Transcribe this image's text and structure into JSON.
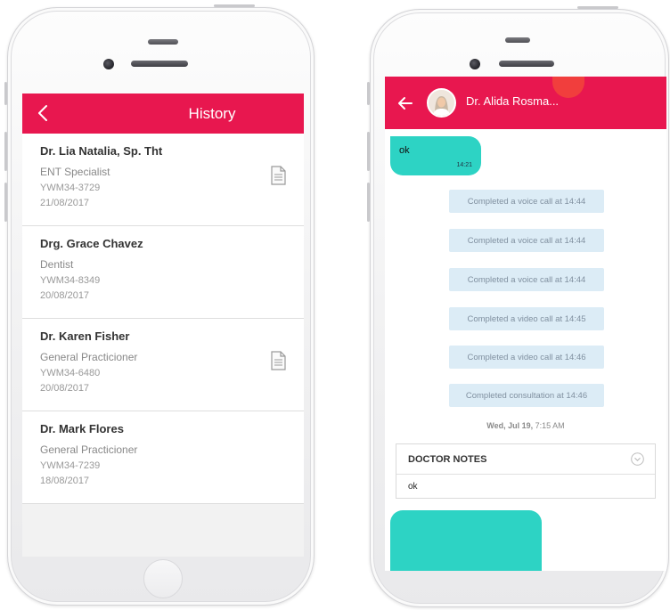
{
  "history_screen": {
    "title": "History",
    "items": [
      {
        "name": "Dr. Lia Natalia, Sp. Tht",
        "specialty": "ENT Specialist",
        "code": "YWM34-3729",
        "date": "21/08/2017",
        "has_document": true
      },
      {
        "name": "Drg. Grace Chavez",
        "specialty": "Dentist",
        "code": "YWM34-8349",
        "date": "20/08/2017",
        "has_document": false
      },
      {
        "name": "Dr. Karen Fisher",
        "specialty": "General Practicioner",
        "code": "YWM34-6480",
        "date": "20/08/2017",
        "has_document": true
      },
      {
        "name": "Dr. Mark Flores",
        "specialty": "General Practicioner",
        "code": "YWM34-7239",
        "date": "18/08/2017",
        "has_document": false
      }
    ]
  },
  "chat_screen": {
    "doctor_name": "Dr. Alida Rosma...",
    "first_message": {
      "text": "ok",
      "time": "14:21"
    },
    "system_messages": [
      "Completed a voice call at 14:44",
      "Completed a voice call at 14:44",
      "Completed a voice call at 14:44",
      "Completed a video call at 14:45",
      "Completed a video call at 14:46",
      "Completed consultation at 14:46"
    ],
    "date_separator_day": "Wed, Jul 19,",
    "date_separator_time": " 7:15 AM",
    "doctor_notes": {
      "label": "DOCTOR NOTES",
      "text": "ok"
    }
  },
  "colors": {
    "accent": "#e8174f",
    "bubble": "#2dd3c4",
    "system_bubble": "#dcecf6"
  }
}
